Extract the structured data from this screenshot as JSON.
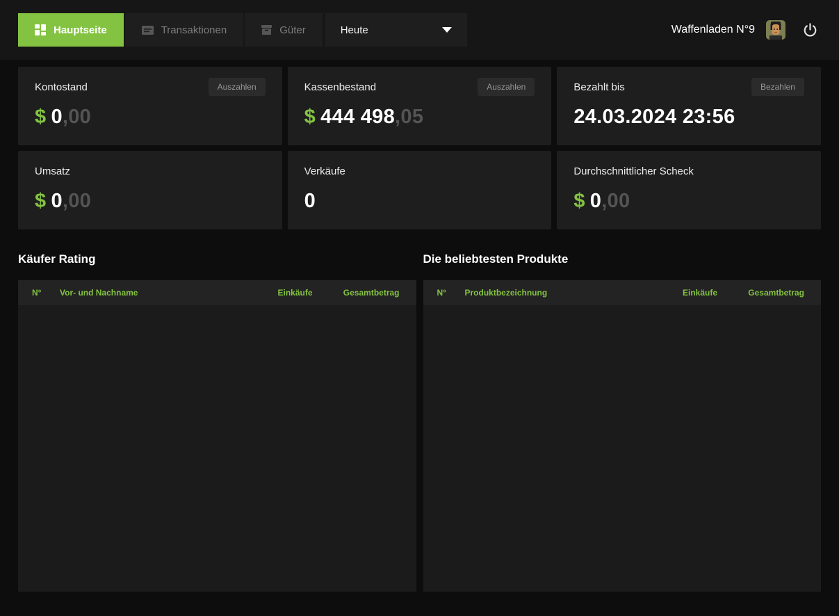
{
  "topbar": {
    "tabs": [
      {
        "label": "Hauptseite",
        "active": true
      },
      {
        "label": "Transaktionen",
        "active": false
      },
      {
        "label": "Güter",
        "active": false
      }
    ],
    "period": {
      "value": "Heute"
    },
    "shop_name": "Waffenladen N°9",
    "icons": {
      "hauptseite": "dashboard-grid-icon",
      "transaktionen": "list-card-icon",
      "gueter": "box-icon",
      "period": "chevron-down-icon",
      "user": "user-avatar",
      "logout": "power-icon"
    }
  },
  "cards": [
    {
      "title": "Kontostand",
      "action": "Auszahlen",
      "currency": "$",
      "amount": "0",
      "decimals": ",00"
    },
    {
      "title": "Kassenbestand",
      "action": "Auszahlen",
      "currency": "$",
      "amount": "444 498",
      "decimals": ",05"
    },
    {
      "title": "Bezahlt bis",
      "action": "Bezahlen",
      "value": "24.03.2024 23:56"
    },
    {
      "title": "Umsatz",
      "currency": "$",
      "amount": "0",
      "decimals": ",00"
    },
    {
      "title": "Verkäufe",
      "value": "0"
    },
    {
      "title": "Durchschnittlicher Scheck",
      "currency": "$",
      "amount": "0",
      "decimals": ",00"
    }
  ],
  "tables": [
    {
      "title": "Käufer Rating",
      "headers": [
        "N°",
        "Vor- und Nachname",
        "Einkäufe",
        "Gesamtbetrag"
      ],
      "rows": []
    },
    {
      "title": "Die beliebtesten Produkte",
      "headers": [
        "N°",
        "Produktbezeichnung",
        "Einkäufe",
        "Gesamtbetrag"
      ],
      "rows": []
    }
  ],
  "colors": {
    "accent_green": "#84c342",
    "page_bg": "#0d0d0d",
    "topbar_bg": "#161616",
    "card_bg": "#1e1e1e",
    "muted_text": "#545454"
  }
}
